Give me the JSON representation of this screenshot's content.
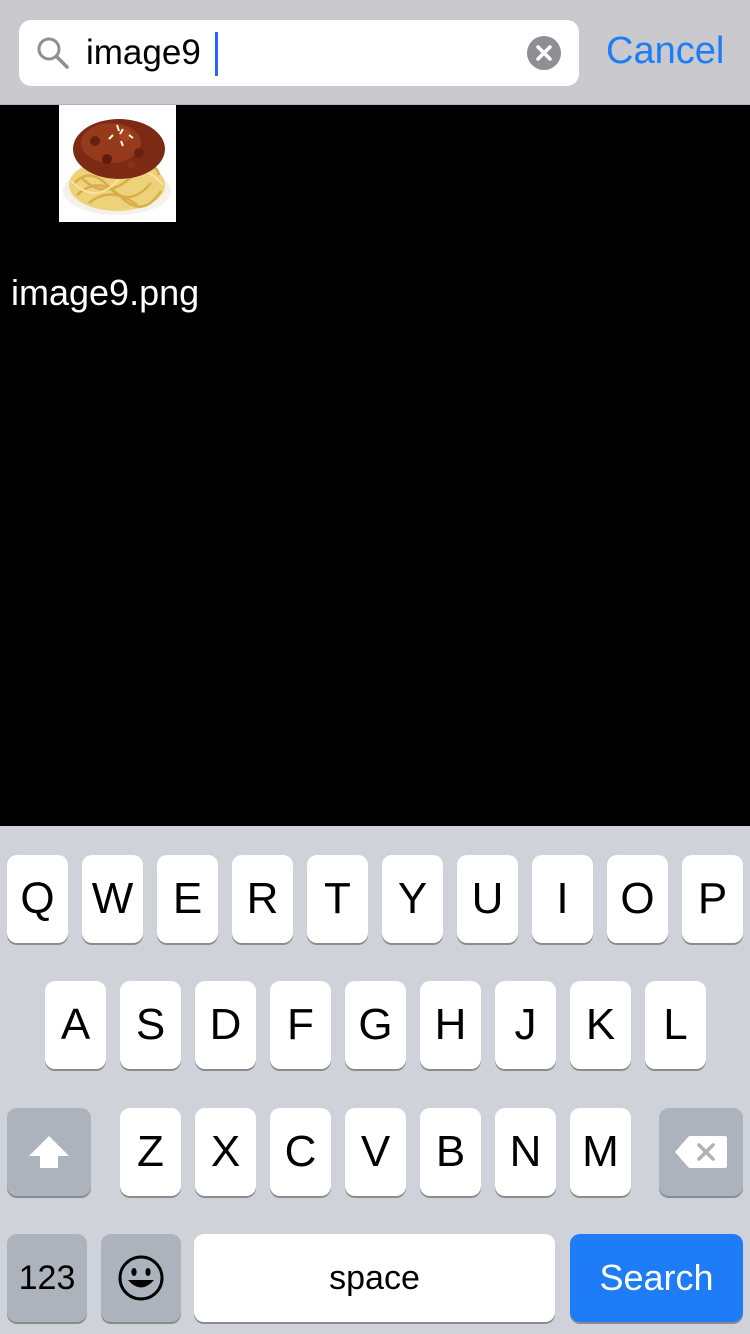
{
  "search": {
    "query": "image9",
    "cancel_label": "Cancel"
  },
  "results": [
    {
      "label": "image9.png",
      "thumbnail": "spaghetti-bolognese-image"
    }
  ],
  "keyboard": {
    "row1": [
      "Q",
      "W",
      "E",
      "R",
      "T",
      "Y",
      "U",
      "I",
      "O",
      "P"
    ],
    "row2": [
      "A",
      "S",
      "D",
      "F",
      "G",
      "H",
      "J",
      "K",
      "L"
    ],
    "row3": [
      "Z",
      "X",
      "C",
      "V",
      "B",
      "N",
      "M"
    ],
    "shift_icon": "shift-arrow-icon",
    "delete_icon": "backspace-icon",
    "numbers_label": "123",
    "emoji_icon": "emoji-face-icon",
    "space_label": "space",
    "search_label": "Search"
  },
  "colors": {
    "accent": "#1e7cf6",
    "header_bg": "#c9c9ce",
    "keyboard_bg": "#cfd3d9",
    "dark_key": "#acb3bc",
    "caret": "#2a66f5"
  }
}
